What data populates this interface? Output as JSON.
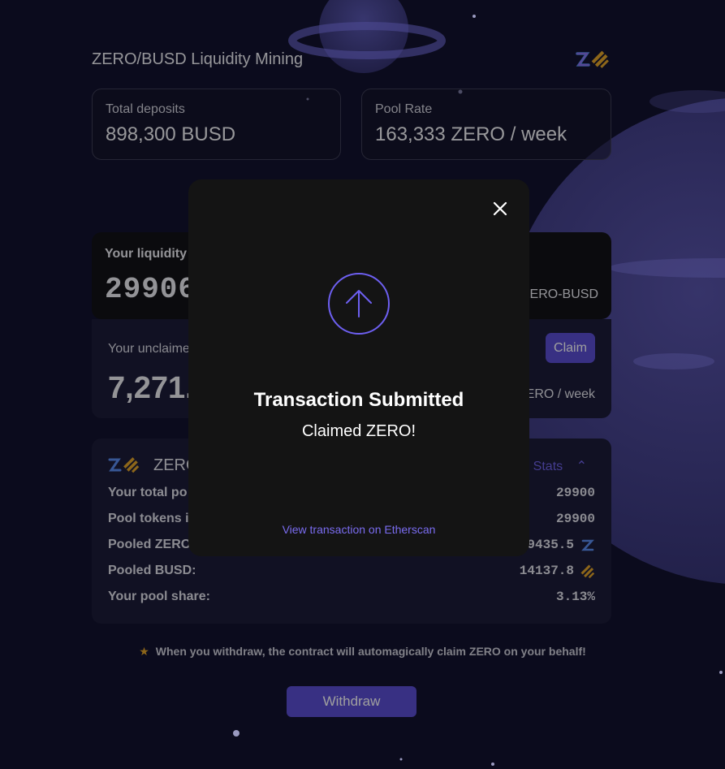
{
  "header": {
    "title": "ZERO/BUSD Liquidity Mining"
  },
  "stats": {
    "total_deposits_label": "Total deposits",
    "total_deposits_value": "898,300 BUSD",
    "pool_rate_label": "Pool Rate",
    "pool_rate_value": "163,333 ZERO / week"
  },
  "liquidity": {
    "label": "Your liquidity",
    "value": "29906",
    "unit": "ZERO-BUSD"
  },
  "rewards": {
    "label": "Your unclaimed",
    "value": "7,271.0",
    "rate": "ERO / week",
    "claim_label": "Claim"
  },
  "pool": {
    "name": "ZERO",
    "stats_toggle": "Stats",
    "rows": [
      {
        "label": "Your total po",
        "value": "29900"
      },
      {
        "label": "Pool tokens i",
        "value": "29900"
      },
      {
        "label": "Pooled ZERO:",
        "value": "9435.5"
      },
      {
        "label": "Pooled BUSD:",
        "value": "14137.8"
      },
      {
        "label": "Your pool share:",
        "value": "3.13%"
      }
    ]
  },
  "note": {
    "text": "When you withdraw, the contract will automagically claim ZERO on your behalf!"
  },
  "withdraw": {
    "label": "Withdraw"
  },
  "modal": {
    "title": "Transaction Submitted",
    "subtitle": "Claimed ZERO!",
    "link": "View transaction on Etherscan"
  },
  "colors": {
    "accent": "#5b4ed4",
    "link": "#7a6cf0",
    "busd_gold": "#e3a52a"
  }
}
